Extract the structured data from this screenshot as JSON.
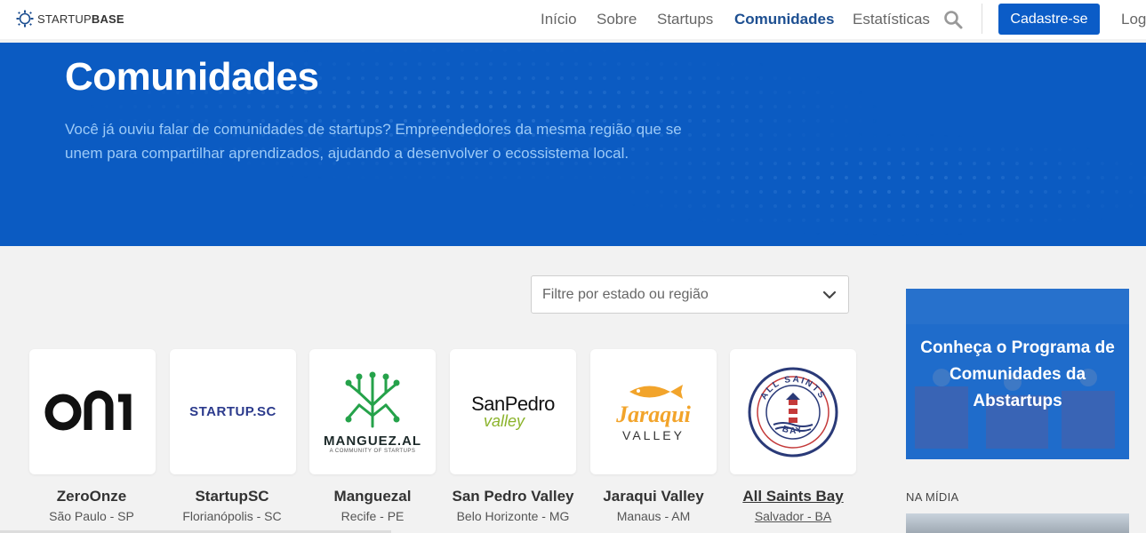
{
  "nav": {
    "logo_prefix": "STARTUP",
    "logo_bold": "BASE",
    "links": [
      "Início",
      "Sobre",
      "Startups",
      "Comunidades",
      "Estatísticas"
    ],
    "active": "Comunidades",
    "cta": "Cadastre-se",
    "login": "Log"
  },
  "hero": {
    "title": "Comunidades",
    "description": "Você já ouviu falar de comunidades de startups? Empreendedores da mesma região que se unem para compartilhar aprendizados, ajudando a desenvolver o ecossistema local."
  },
  "filter": {
    "placeholder": "Filtre por estado ou região"
  },
  "communities": [
    {
      "name": "ZeroOnze",
      "location": "São Paulo - SP",
      "logo_text": "on"
    },
    {
      "name": "StartupSC",
      "location": "Florianópolis - SC",
      "logo_text": "STARTUP.SC"
    },
    {
      "name": "Manguezal",
      "location": "Recife - PE",
      "logo_text": "MANGUEZ.AL",
      "logo_sub": "A COMMUNITY OF STARTUPS"
    },
    {
      "name": "San Pedro Valley",
      "location": "Belo Horizonte - MG",
      "logo_text": "SanPedro",
      "logo_sub": "valley"
    },
    {
      "name": "Jaraqui Valley",
      "location": "Manaus - AM",
      "logo_text": "Jaraqui",
      "logo_sub": "VALLEY"
    },
    {
      "name": "All Saints Bay",
      "location": "Salvador - BA",
      "logo_text": "ALL SAINTS",
      "logo_sub": "BAY"
    }
  ],
  "promo": {
    "text": "Conheça o Programa de Comunidades da Abstartups"
  },
  "media": {
    "heading": "NA MÍDIA"
  },
  "colors": {
    "primary": "#0b5cc7",
    "hero_bg": "#0b5bc2",
    "active_link": "#1d4f91",
    "hero_text": "#9ccaf7"
  }
}
